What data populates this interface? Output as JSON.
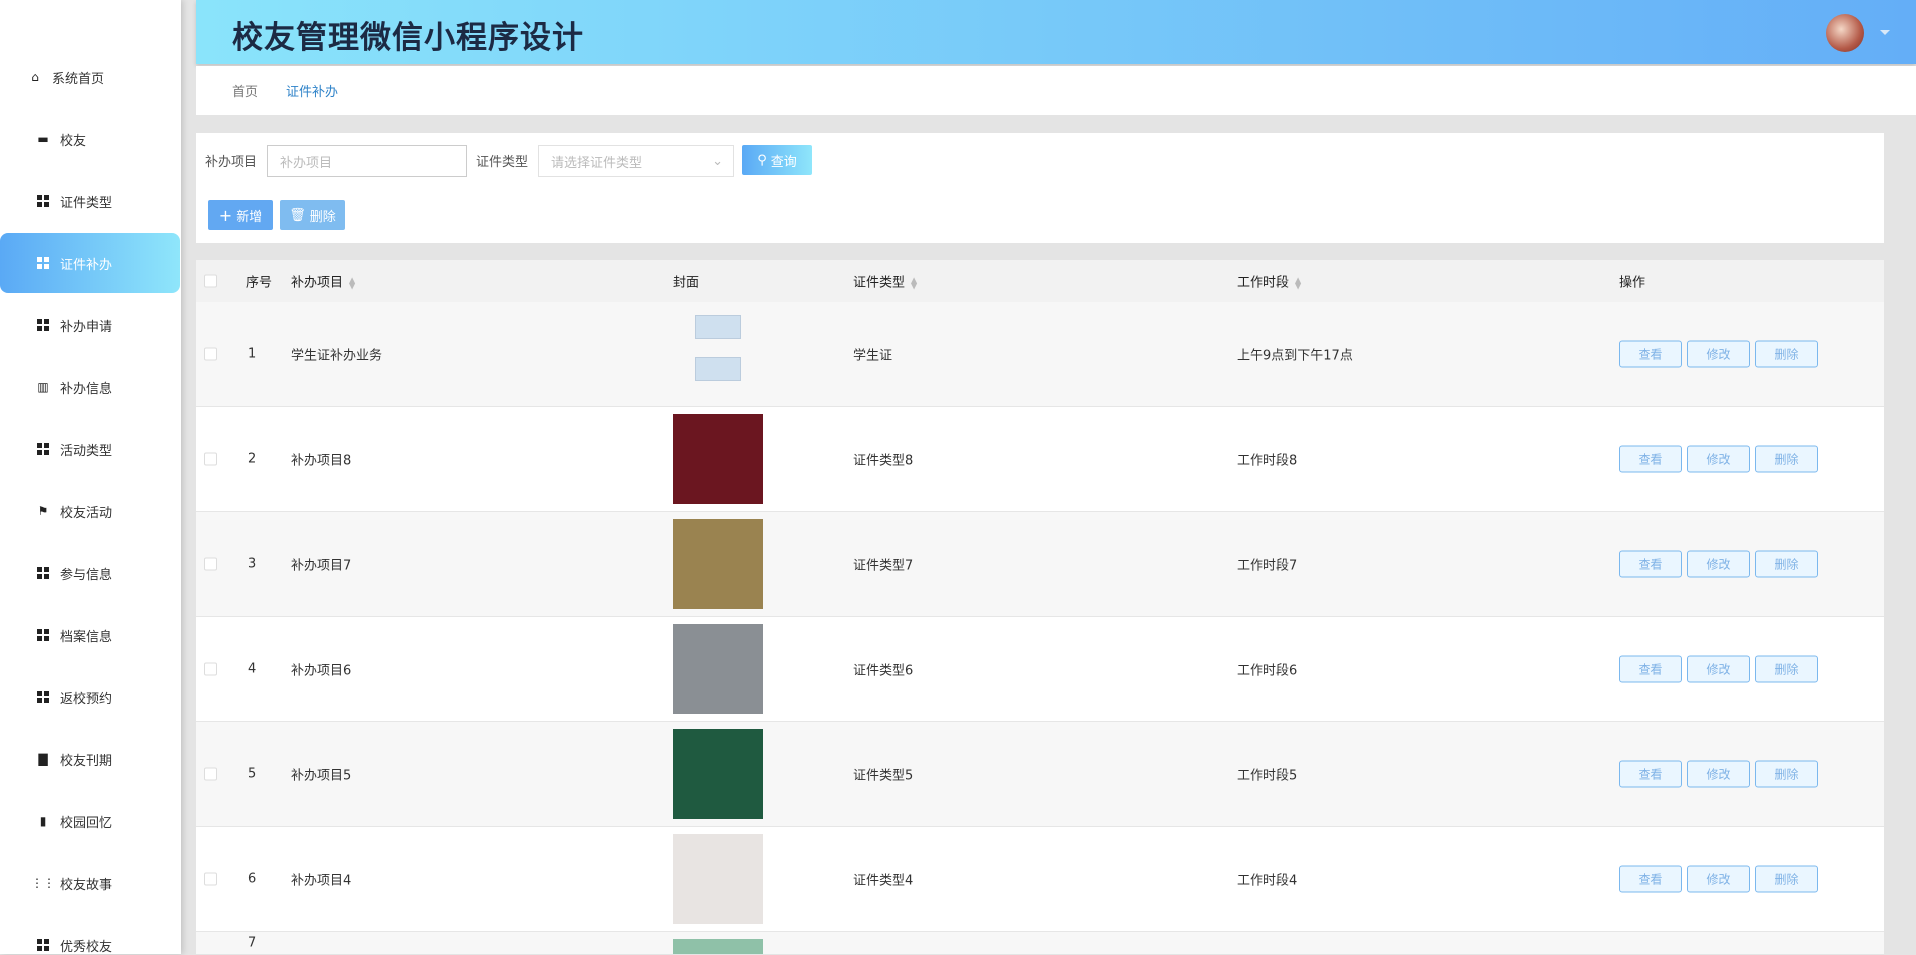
{
  "header": {
    "title": "校友管理微信小程序设计"
  },
  "breadcrumb": [
    "首页",
    "证件补办"
  ],
  "sidebar": {
    "items": [
      {
        "label": "系统首页",
        "icon": "home-icon"
      },
      {
        "label": "校友",
        "icon": "briefcase-icon"
      },
      {
        "label": "证件类型",
        "icon": "grid-icon"
      },
      {
        "label": "证件补办",
        "icon": "grid-icon",
        "active": true
      },
      {
        "label": "补办申请",
        "icon": "grid-icon"
      },
      {
        "label": "补办信息",
        "icon": "bar-chart-icon"
      },
      {
        "label": "活动类型",
        "icon": "grid-icon"
      },
      {
        "label": "校友活动",
        "icon": "flag-icon"
      },
      {
        "label": "参与信息",
        "icon": "grid-icon"
      },
      {
        "label": "档案信息",
        "icon": "grid-icon"
      },
      {
        "label": "返校预约",
        "icon": "grid-icon"
      },
      {
        "label": "校友刊期",
        "icon": "book-icon"
      },
      {
        "label": "校园回忆",
        "icon": "library-icon"
      },
      {
        "label": "校友故事",
        "icon": "apps-icon"
      },
      {
        "label": "优秀校友",
        "icon": "grid-icon"
      }
    ]
  },
  "search": {
    "item_label": "补办项目",
    "item_placeholder": "补办项目",
    "type_label": "证件类型",
    "type_placeholder": "请选择证件类型",
    "query": "查询",
    "add": "新增",
    "delete": "删除"
  },
  "table": {
    "headers": {
      "index": "序号",
      "item": "补办项目",
      "cover": "封面",
      "type": "证件类型",
      "time": "工作时段",
      "ops": "操作"
    },
    "actions": {
      "view": "查看",
      "edit": "修改",
      "delete": "删除"
    },
    "rows": [
      {
        "index": "1",
        "item": "学生证补办业务",
        "type": "学生证",
        "time": "上午9点到下午17点",
        "color": "#cfe0ef"
      },
      {
        "index": "2",
        "item": "补办项目8",
        "type": "证件类型8",
        "time": "工作时段8",
        "color": "#6b1620"
      },
      {
        "index": "3",
        "item": "补办项目7",
        "type": "证件类型7",
        "time": "工作时段7",
        "color": "#9a8350"
      },
      {
        "index": "4",
        "item": "补办项目6",
        "type": "证件类型6",
        "time": "工作时段6",
        "color": "#8a8f94"
      },
      {
        "index": "5",
        "item": "补办项目5",
        "type": "证件类型5",
        "time": "工作时段5",
        "color": "#1f5a40"
      },
      {
        "index": "6",
        "item": "补办项目4",
        "type": "证件类型4",
        "time": "工作时段4",
        "color": "#e8e4e2"
      },
      {
        "index": "7",
        "item": "",
        "type": "",
        "time": "",
        "color": "#8fc1a8"
      }
    ]
  }
}
